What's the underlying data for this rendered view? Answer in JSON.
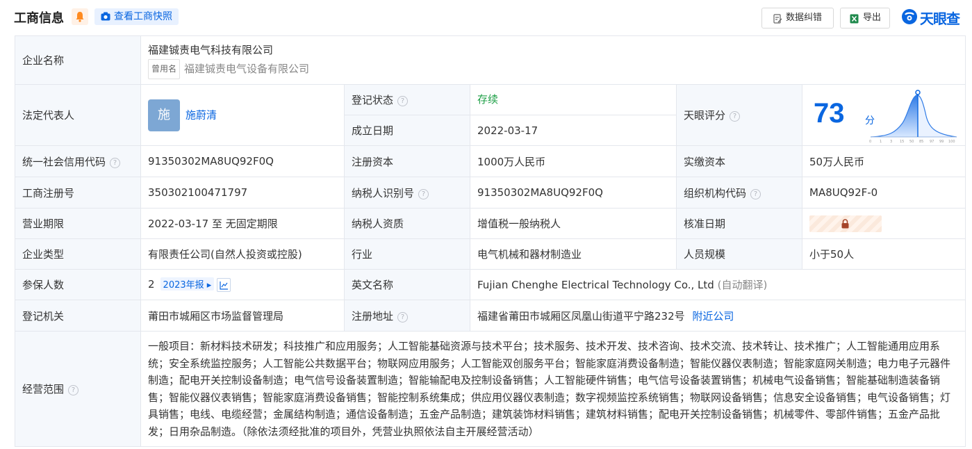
{
  "header": {
    "title": "工商信息",
    "snapshot_label": "查看工商快照",
    "correct_label": "数据纠错",
    "export_label": "导出",
    "logo_text": "天眼查"
  },
  "labels": {
    "company_name": "企业名称",
    "legal_rep": "法定代表人",
    "reg_status": "登记状态",
    "established": "成立日期",
    "tianyan_score": "天眼评分",
    "credit_code": "统一社会信用代码",
    "reg_capital": "注册资本",
    "paid_capital": "实缴资本",
    "reg_no": "工商注册号",
    "taxpayer_id": "纳税人识别号",
    "org_code": "组织机构代码",
    "business_term": "营业期限",
    "taxpayer_qual": "纳税人资质",
    "approval_date": "核准日期",
    "company_type": "企业类型",
    "industry": "行业",
    "staff_size": "人员规模",
    "insured": "参保人数",
    "english_name": "英文名称",
    "reg_authority": "登记机关",
    "reg_address": "注册地址",
    "business_scope": "经营范围"
  },
  "values": {
    "company_name": "福建铖责电气科技有限公司",
    "used_name_tag": "曾用名",
    "used_name": "福建铖责电气设备有限公司",
    "legal_rep_avatar": "施",
    "legal_rep": "施蔚清",
    "reg_status": "存续",
    "established": "2022-03-17",
    "score": "73",
    "score_unit": "分",
    "score_ticks": [
      "0",
      "1",
      "3",
      "15",
      "50",
      "85",
      "97",
      "99",
      "100"
    ],
    "credit_code": "91350302MA8UQ92F0Q",
    "reg_capital": "1000万人民币",
    "paid_capital": "50万人民币",
    "reg_no": "350302100471797",
    "taxpayer_id": "91350302MA8UQ92F0Q",
    "org_code": "MA8UQ92F-0",
    "business_term": "2022-03-17 至 无固定期限",
    "taxpayer_qual": "增值税一般纳税人",
    "company_type": "有限责任公司(自然人投资或控股)",
    "industry": "电气机械和器材制造业",
    "staff_size": "小于50人",
    "insured": "2",
    "insured_year": "2023年报",
    "english_name": "Fujian Chenghe Electrical Technology Co., Ltd",
    "english_note": "(自动翻译)",
    "reg_authority": "莆田市城厢区市场监督管理局",
    "reg_address": "福建省莆田市城厢区凤凰山街道平宁路232号",
    "nearby": "附近公司",
    "business_scope": "一般项目：新材料技术研发；科技推广和应用服务；人工智能基础资源与技术平台；技术服务、技术开发、技术咨询、技术交流、技术转让、技术推广；人工智能通用应用系统；安全系统监控服务；人工智能公共数据平台；物联网应用服务；人工智能双创服务平台；智能家庭消费设备制造；智能仪器仪表制造；智能家庭网关制造；电力电子元器件制造；配电开关控制设备制造；电气信号设备装置制造；智能输配电及控制设备销售；人工智能硬件销售；电气信号设备装置销售；机械电气设备销售；智能基础制造装备销售；智能仪器仪表销售；智能家庭消费设备销售；智能控制系统集成；供应用仪器仪表制造；数字视频监控系统销售；物联网设备销售；信息安全设备销售；电气设备销售；灯具销售；电线、电缆经营；金属结构制造；通信设备制造；五金产品制造；建筑装饰材料销售；建筑材料销售；配电开关控制设备销售；机械零件、零部件销售；五金产品批发；日用杂品制造。（除依法须经批准的项目外，凭营业执照依法自主开展经营活动）"
  },
  "colors": {
    "accent": "#0a66e0",
    "status_green": "#20a048",
    "label_bg": "#f5f8fc"
  }
}
